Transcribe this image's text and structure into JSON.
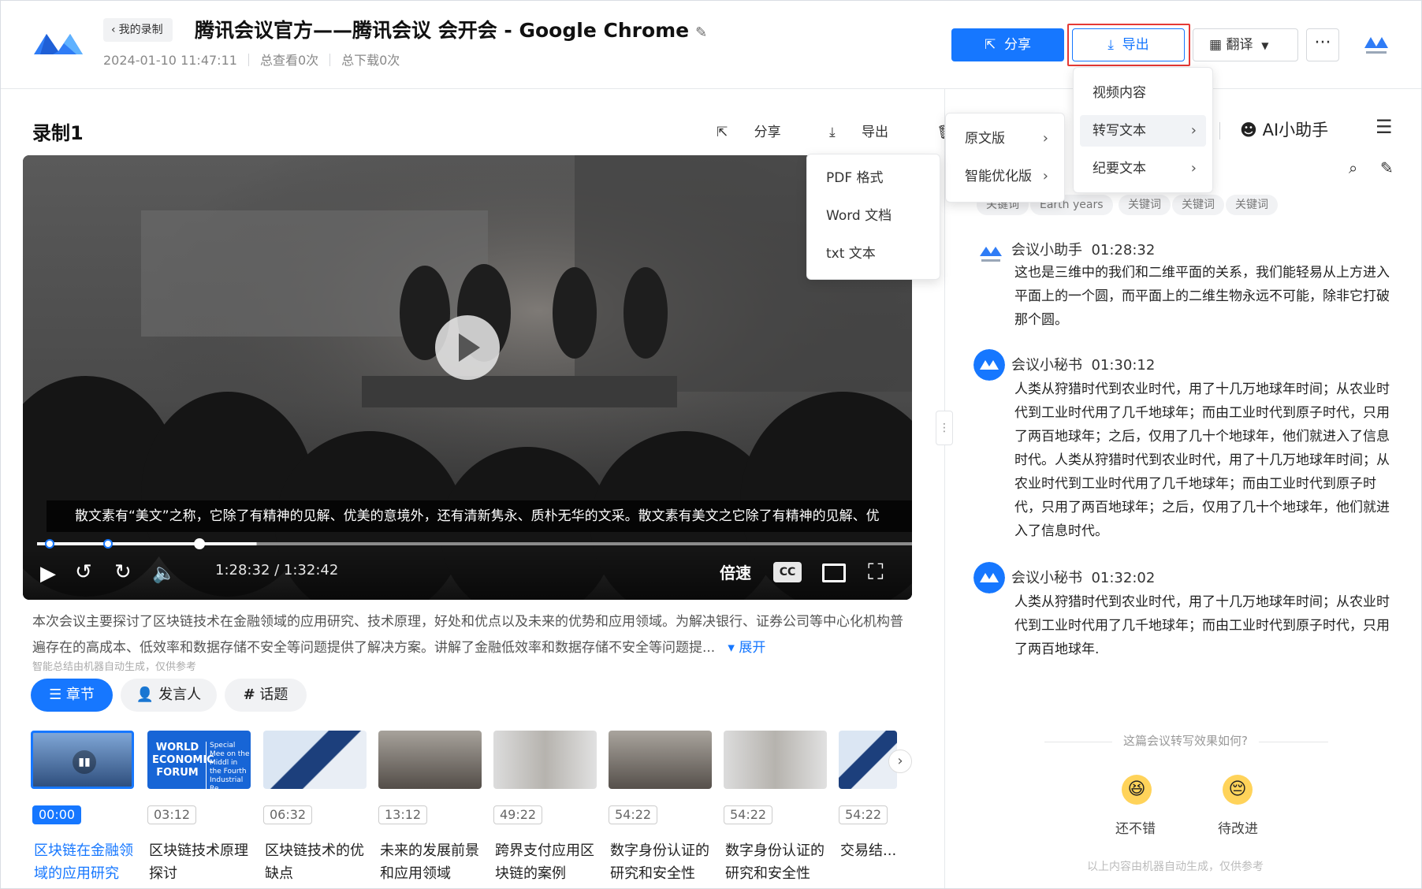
{
  "header": {
    "back_label": "我的录制",
    "title": "腾讯会议官方——腾讯会议 会开会 - Google Chrome",
    "date": "2024-01-10 11:47:11",
    "views": "总查看0次",
    "downloads": "总下载0次",
    "share_label": "分享",
    "export_label": "导出",
    "translate_label": "翻译",
    "more_label": "···"
  },
  "recording": {
    "title": "录制1",
    "share": "分享",
    "export": "导出",
    "delete": "删除",
    "subtitle": "散文素有“美文”之称，它除了有精神的见解、优美的意境外，还有清新隽永、质朴无华的文采。散文素有美文之它除了有精神的见解、优",
    "time": "1:28:32 / 1:32:42",
    "speed": "倍速",
    "cc": "CC",
    "progress_fraction": 0.25
  },
  "summary": {
    "text": "本次会议主要探讨了区块链技术在金融领域的应用研究、技术原理，好处和优点以及未来的优势和应用领域。为解决银行、证券公司等中心化机构普遍存在的高成本、低效率和数据存储不安全等问题提供了解决方案。讲解了金融低效率和数据存储不安全等问题提...",
    "expand": "展开",
    "note": "智能总结由机器自动生成，仅供参考"
  },
  "tabs": [
    "章节",
    "发言人",
    "话题"
  ],
  "chapters": [
    {
      "time": "00:00",
      "title": "区块链在金融领域的应用研究"
    },
    {
      "time": "03:12",
      "title": "区块链技术原理探讨"
    },
    {
      "time": "06:32",
      "title": "区块链技术的优缺点"
    },
    {
      "time": "13:12",
      "title": "未来的发展前景和应用领域"
    },
    {
      "time": "49:22",
      "title": "跨界支付应用区块链的案例"
    },
    {
      "time": "54:22",
      "title": "数字身份认证的研究和安全性"
    },
    {
      "time": "54:22",
      "title": "数字身份认证的研究和安全性"
    },
    {
      "time": "54:22",
      "title": "交易结..."
    }
  ],
  "thumb2_text": {
    "line1": "WORLD",
    "line2": "ECONOMIC",
    "line3": "FORUM",
    "side": "Special Mee on the Middl in the Fourth Industrial Re"
  },
  "right": {
    "ai_assistant": "AI小助手",
    "keywords": [
      "关键词",
      "Earth years",
      "关键词",
      "关键词",
      "关键词"
    ],
    "messages": [
      {
        "name": "会议小助手",
        "time": "01:28:32",
        "text": "这也是三维中的我们和二维平面的关系，我们能轻易从上方进入平面上的一个圆，而平面上的二维生物永远不可能，除非它打破那个圆。"
      },
      {
        "name": "会议小秘书",
        "time": "01:30:12",
        "text": "人类从狩猎时代到农业时代，用了十几万地球年时间；从农业时代到工业时代用了几千地球年；而由工业时代到原子时代，只用了两百地球年；之后，仅用了几十个地球年，他们就进入了信息时代。人类从狩猎时代到农业时代，用了十几万地球年时间；从农业时代到工业时代用了几千地球年；而由工业时代到原子时代，只用了两百地球年；之后，仅用了几十个地球年，他们就进入了信息时代。"
      },
      {
        "name": "会议小秘书",
        "time": "01:32:02",
        "text": "人类从狩猎时代到农业时代，用了十几万地球年时间；从农业时代到工业时代用了几千地球年；而由工业时代到原子时代，只用了两百地球年."
      }
    ],
    "rating_question": "这篇会议转写效果如何?",
    "rating_good": "还不错",
    "rating_bad": "待改进",
    "footnote": "以上内容由机器自动生成，仅供参考"
  },
  "export_menu": [
    "视频内容",
    "转写文本",
    "纪要文本"
  ],
  "version_menu": [
    "原文版",
    "智能优化版"
  ],
  "format_menu": [
    "PDF 格式",
    "Word 文档",
    "txt 文本"
  ],
  "colors": {
    "accent": "#1677ff",
    "highlight": "#e53935"
  }
}
